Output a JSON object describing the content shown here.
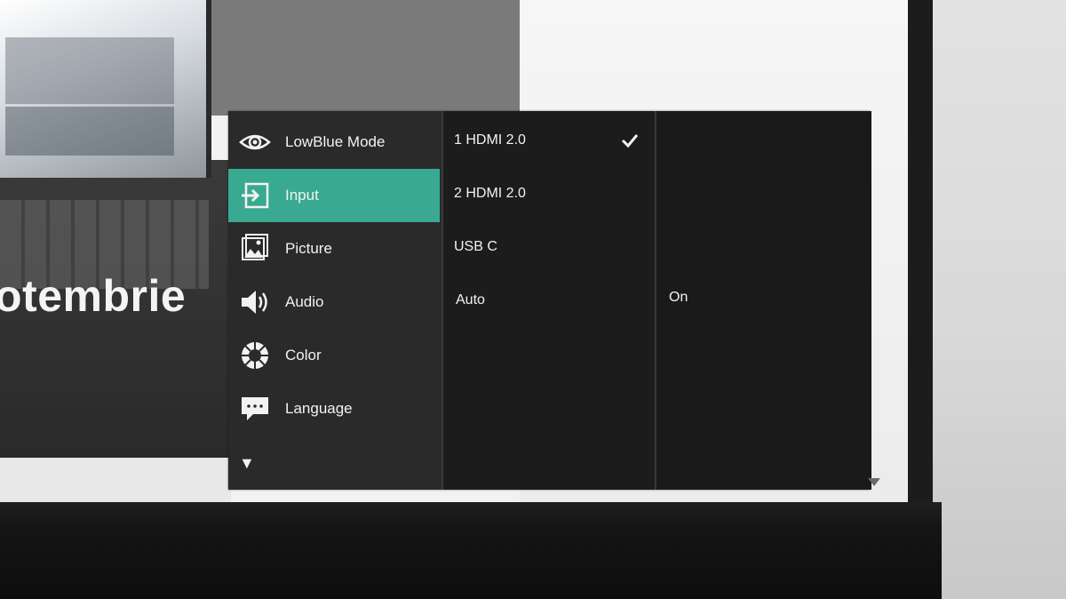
{
  "background": {
    "promo_text": "otembrie"
  },
  "osd": {
    "nav": [
      {
        "label": "LowBlue Mode",
        "icon": "eye-icon"
      },
      {
        "label": "Input",
        "icon": "input-icon"
      },
      {
        "label": "Picture",
        "icon": "picture-icon"
      },
      {
        "label": "Audio",
        "icon": "speaker-icon"
      },
      {
        "label": "Color",
        "icon": "color-wheel-icon"
      },
      {
        "label": "Language",
        "icon": "speech-bubble-icon"
      }
    ],
    "active_nav": "Input",
    "more_indicator": "▼",
    "submenu": [
      {
        "label": "1 HDMI 2.0",
        "selected": true
      },
      {
        "label": "2 HDMI 2.0",
        "selected": false
      },
      {
        "label": "USB C",
        "selected": false
      },
      {
        "label": "Auto",
        "selected": false
      }
    ],
    "auto_value": "On"
  },
  "colors": {
    "accent": "#3aa992",
    "menu_bg": "#1f1d1d",
    "text": "#f2f2f2"
  }
}
